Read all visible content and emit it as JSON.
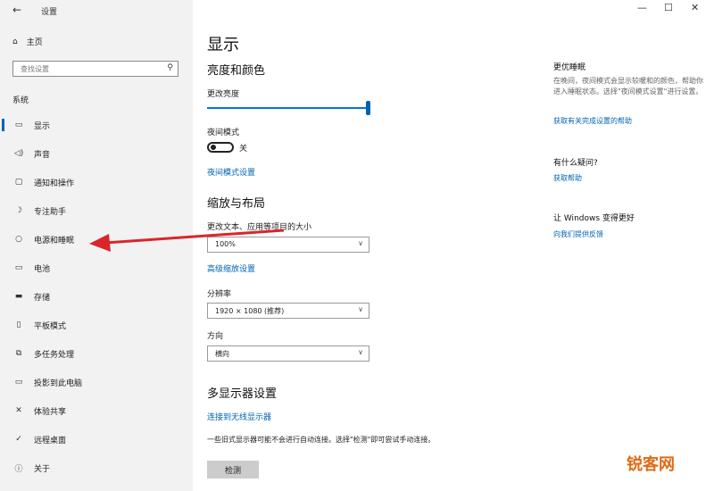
{
  "app": {
    "title": "设置"
  },
  "sidebar": {
    "home": "主页",
    "search_placeholder": "查找设置",
    "section": "系统",
    "items": [
      {
        "label": "显示",
        "icon": "display-icon",
        "glyph": "▭",
        "active": true
      },
      {
        "label": "声音",
        "icon": "speaker-icon",
        "glyph": "◁)"
      },
      {
        "label": "通知和操作",
        "icon": "notification-icon",
        "glyph": "▢"
      },
      {
        "label": "专注助手",
        "icon": "moon-icon",
        "glyph": "☽"
      },
      {
        "label": "电源和睡眠",
        "icon": "power-icon",
        "glyph": "○"
      },
      {
        "label": "电池",
        "icon": "battery-icon",
        "glyph": "▭"
      },
      {
        "label": "存储",
        "icon": "storage-icon",
        "glyph": "▬"
      },
      {
        "label": "平板模式",
        "icon": "tablet-icon",
        "glyph": "▯"
      },
      {
        "label": "多任务处理",
        "icon": "multitask-icon",
        "glyph": "⧉"
      },
      {
        "label": "投影到此电脑",
        "icon": "project-icon",
        "glyph": "▭"
      },
      {
        "label": "体验共享",
        "icon": "share-icon",
        "glyph": "✕"
      },
      {
        "label": "远程桌面",
        "icon": "remote-icon",
        "glyph": "✓"
      },
      {
        "label": "关于",
        "icon": "info-icon",
        "glyph": "ⓘ"
      }
    ]
  },
  "main": {
    "title": "显示",
    "brightness": {
      "heading": "亮度和颜色",
      "label": "更改亮度",
      "night_label": "夜间模式",
      "night_state": "关",
      "night_link": "夜间模式设置"
    },
    "layout": {
      "heading": "缩放与布局",
      "scale_label": "更改文本、应用等项目的大小",
      "scale_value": "100%",
      "scale_link": "高级缩放设置",
      "resolution_label": "分辨率",
      "resolution_value": "1920 × 1080 (推荐)",
      "orientation_label": "方向",
      "orientation_value": "横向"
    },
    "multi": {
      "heading": "多显示器设置",
      "link": "连接到无线显示器",
      "desc": "一些旧式显示器可能不会进行自动连接。选择\"检测\"即可尝试手动连接。",
      "button": "检测"
    }
  },
  "right": {
    "sleep_heading": "更优睡眠",
    "sleep_desc": "在晚间，夜间模式会显示较暖和的颜色，帮助你进入睡眠状态。选择\"夜间模式设置\"进行设置。",
    "sleep_link": "获取有关完成设置的帮助",
    "question_heading": "有什么疑问?",
    "question_link": "获取帮助",
    "better_heading": "让 Windows 变得更好",
    "better_link": "向我们提供反馈"
  },
  "window_controls": {
    "minimize": "—",
    "maximize": "☐",
    "close": "✕"
  },
  "watermark": "锐客网",
  "colors": {
    "accent": "#0063b1",
    "arrow": "#d9262b"
  }
}
